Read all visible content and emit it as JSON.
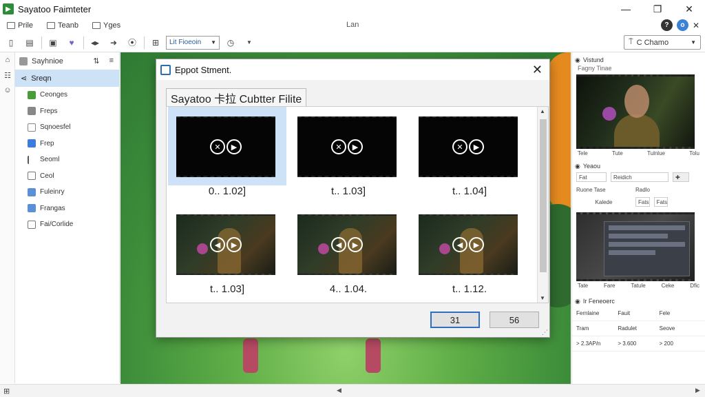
{
  "window": {
    "title": "Sayatoo Faimteter",
    "minimize": "—",
    "maximize": "❐",
    "close": "✕"
  },
  "menubar": {
    "items": [
      "Prile",
      "Teanb",
      "Yges"
    ],
    "center": "Lan"
  },
  "toolbar": {
    "select_value": "Lit Fioeoin",
    "right_select": "C Chamo"
  },
  "sidebar": {
    "header": "Sayhnioe",
    "selected": "Sreqn",
    "items": [
      "Ceonges",
      "Freps",
      "Sqnoesfel",
      "Frep",
      "Seoml",
      "Ceol",
      "Fuleinry",
      "Frangas",
      "Fai/Corlide"
    ]
  },
  "dialog": {
    "title": "Eppot Stment.",
    "tab": "Sayatoo 卡拉 Cubtter Filite",
    "thumbnails": [
      {
        "label": "0.. 1.02]",
        "scene": false,
        "selected": true
      },
      {
        "label": "t.. 1.03]",
        "scene": false,
        "selected": false
      },
      {
        "label": "t.. 1.04]",
        "scene": false,
        "selected": false
      },
      {
        "label": "t.. 1.03]",
        "scene": true,
        "selected": false
      },
      {
        "label": "4.. 1.04.",
        "scene": true,
        "selected": false
      },
      {
        "label": "t.. 1.12.",
        "scene": true,
        "selected": false
      }
    ],
    "button_primary": "31",
    "button_secondary": "56"
  },
  "right_panel": {
    "section1_title": "Vistund",
    "section1_sub": "Fagny Tinae",
    "preview1_labels": [
      "Tele",
      "Tute",
      "Tulnlue",
      "Tolu"
    ],
    "section2_title": "Yeaou",
    "form_row1": [
      "Fat",
      "Reidich"
    ],
    "form_row2": [
      "Ruone Tase",
      "Radlo"
    ],
    "form_row3": [
      "Kalede",
      "Fats",
      "Fats"
    ],
    "preview2_labels": [
      "Tate",
      "Fare",
      "Tatule",
      "Ceke",
      "Dfic"
    ],
    "section3_title": "Ir Feneoerc",
    "table_header": [
      "Fernlaine",
      "Fauit",
      "Fele"
    ],
    "table_row1": [
      "Tram",
      "Radulet",
      "Seove"
    ],
    "table_row2": [
      "> 2.3AP/n",
      "> 3.600",
      "> 200"
    ]
  },
  "colors": {
    "accent": "#2f6fc2",
    "selection": "#cde2f7",
    "app_icon": "#2e8b3a"
  }
}
